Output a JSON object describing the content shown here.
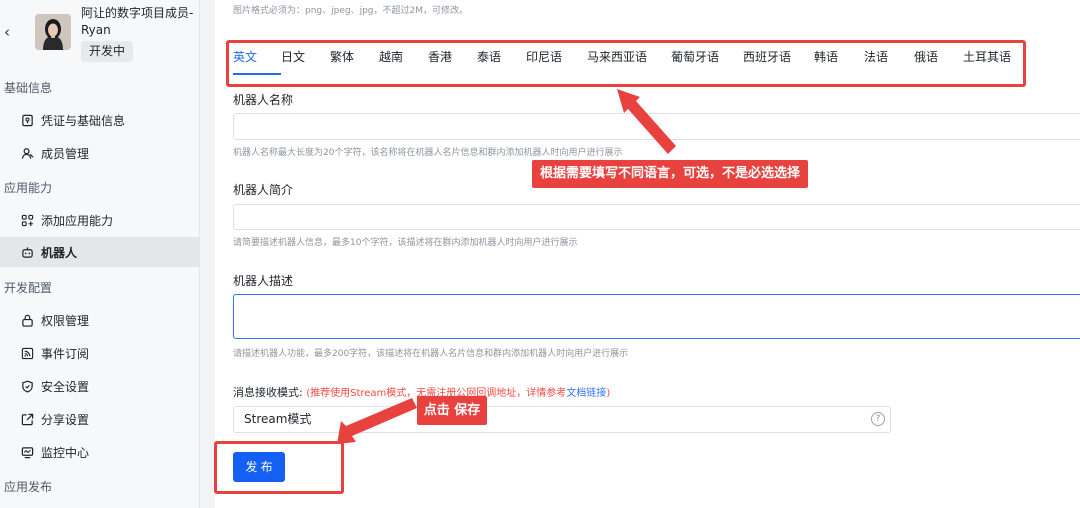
{
  "app": {
    "title": "阿让的数字项目成员-Ryan",
    "status_badge": "开发中"
  },
  "sidebar": {
    "sections": [
      {
        "label": "基础信息"
      },
      {
        "label": "应用能力"
      },
      {
        "label": "开发配置"
      },
      {
        "label": "应用发布"
      }
    ],
    "items": [
      {
        "label": "凭证与基础信息",
        "icon": "credential-icon"
      },
      {
        "label": "成员管理",
        "icon": "member-icon"
      },
      {
        "label": "添加应用能力",
        "icon": "grid-plus-icon"
      },
      {
        "label": "机器人",
        "icon": "robot-icon",
        "active": true
      },
      {
        "label": "权限管理",
        "icon": "lock-icon"
      },
      {
        "label": "事件订阅",
        "icon": "rss-icon"
      },
      {
        "label": "安全设置",
        "icon": "shield-icon"
      },
      {
        "label": "分享设置",
        "icon": "share-icon"
      },
      {
        "label": "监控中心",
        "icon": "monitor-icon"
      }
    ]
  },
  "main": {
    "top_hint": "图片格式必须为：png、jpeg、jpg，不超过2M，可修改。",
    "tabs": [
      {
        "label": "英文",
        "active": true
      },
      {
        "label": "日文"
      },
      {
        "label": "繁体"
      },
      {
        "label": "越南"
      },
      {
        "label": "香港"
      },
      {
        "label": "泰语"
      },
      {
        "label": "印尼语"
      },
      {
        "label": "马来西亚语"
      },
      {
        "label": "葡萄牙语"
      },
      {
        "label": "西班牙语"
      },
      {
        "label": "韩语"
      },
      {
        "label": "法语"
      },
      {
        "label": "俄语"
      },
      {
        "label": "土耳其语"
      }
    ],
    "fields": {
      "name": {
        "label": "机器人名称",
        "value": "",
        "hint": "机器人名称最大长度为20个字符，该名称将在机器人名片信息和群内添加机器人时向用户进行展示"
      },
      "intro": {
        "label": "机器人简介",
        "value": "",
        "hint": "请简要描述机器人信息，最多10个字符，该描述将在群内添加机器人时向用户进行展示"
      },
      "desc": {
        "label": "机器人描述",
        "value": "",
        "hint": "请描述机器人功能，最多200字符，该描述将在机器人名片信息和群内添加机器人时向用户进行展示"
      }
    },
    "message_mode": {
      "label": "消息接收模式:",
      "note": "(推荐使用Stream模式，无需注册公网回调地址，详情参考",
      "link": "文档链接",
      "note_end": ")",
      "selected": "Stream模式",
      "help_icon": "question-circle-icon"
    },
    "publish_button": "发 布"
  },
  "annotations": {
    "tabs_note": "根据需要填写不同语言，可选，不是必选选择",
    "save_note": "点击 保存",
    "color": "#e8423f"
  }
}
